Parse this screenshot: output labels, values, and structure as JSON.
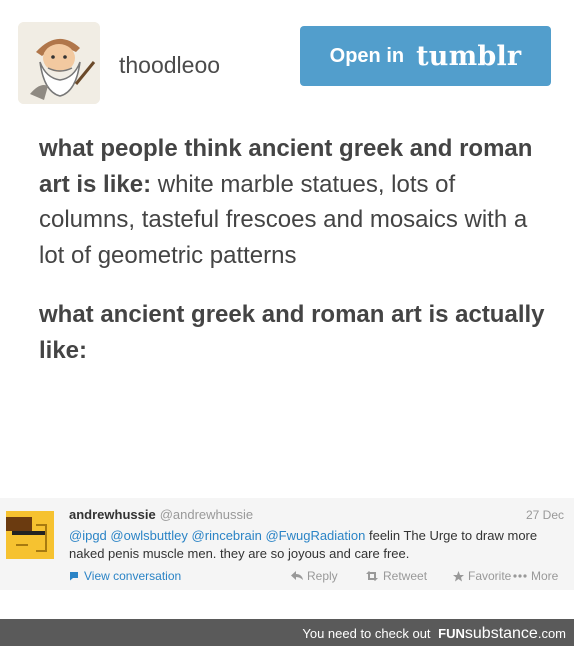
{
  "header": {
    "username": "thoodleoo",
    "open_button": {
      "label": "Open in",
      "brand": "tumblr"
    }
  },
  "post": {
    "p1_bold": "what people think ancient greek and roman art is like:",
    "p1_text": " white marble statues, lots of columns, tasteful frescoes and mosaics with a lot of geometric patterns",
    "p2_bold": "what ancient greek and roman art is actually like:"
  },
  "tweet": {
    "name": "andrewhussie",
    "handle": "@andrewhussie",
    "date": "27 Dec",
    "mentions": [
      "@ipgd",
      "@owlsbuttley",
      "@rincebrain",
      "@FwugRadiation"
    ],
    "text": " feelin The Urge to draw more naked penis muscle men. they are so joyous and care free.",
    "view_conversation": "View conversation",
    "actions": {
      "reply": "Reply",
      "retweet": "Retweet",
      "favorite": "Favorite",
      "more": "More"
    }
  },
  "footer": {
    "text": "You need to check out",
    "brand_a": "FUN",
    "brand_b": "substance",
    "brand_c": ".com"
  },
  "colors": {
    "tumblr_button": "#529ecc",
    "link_blue": "#2b84c6",
    "footer_bg": "#5a5a5a"
  }
}
